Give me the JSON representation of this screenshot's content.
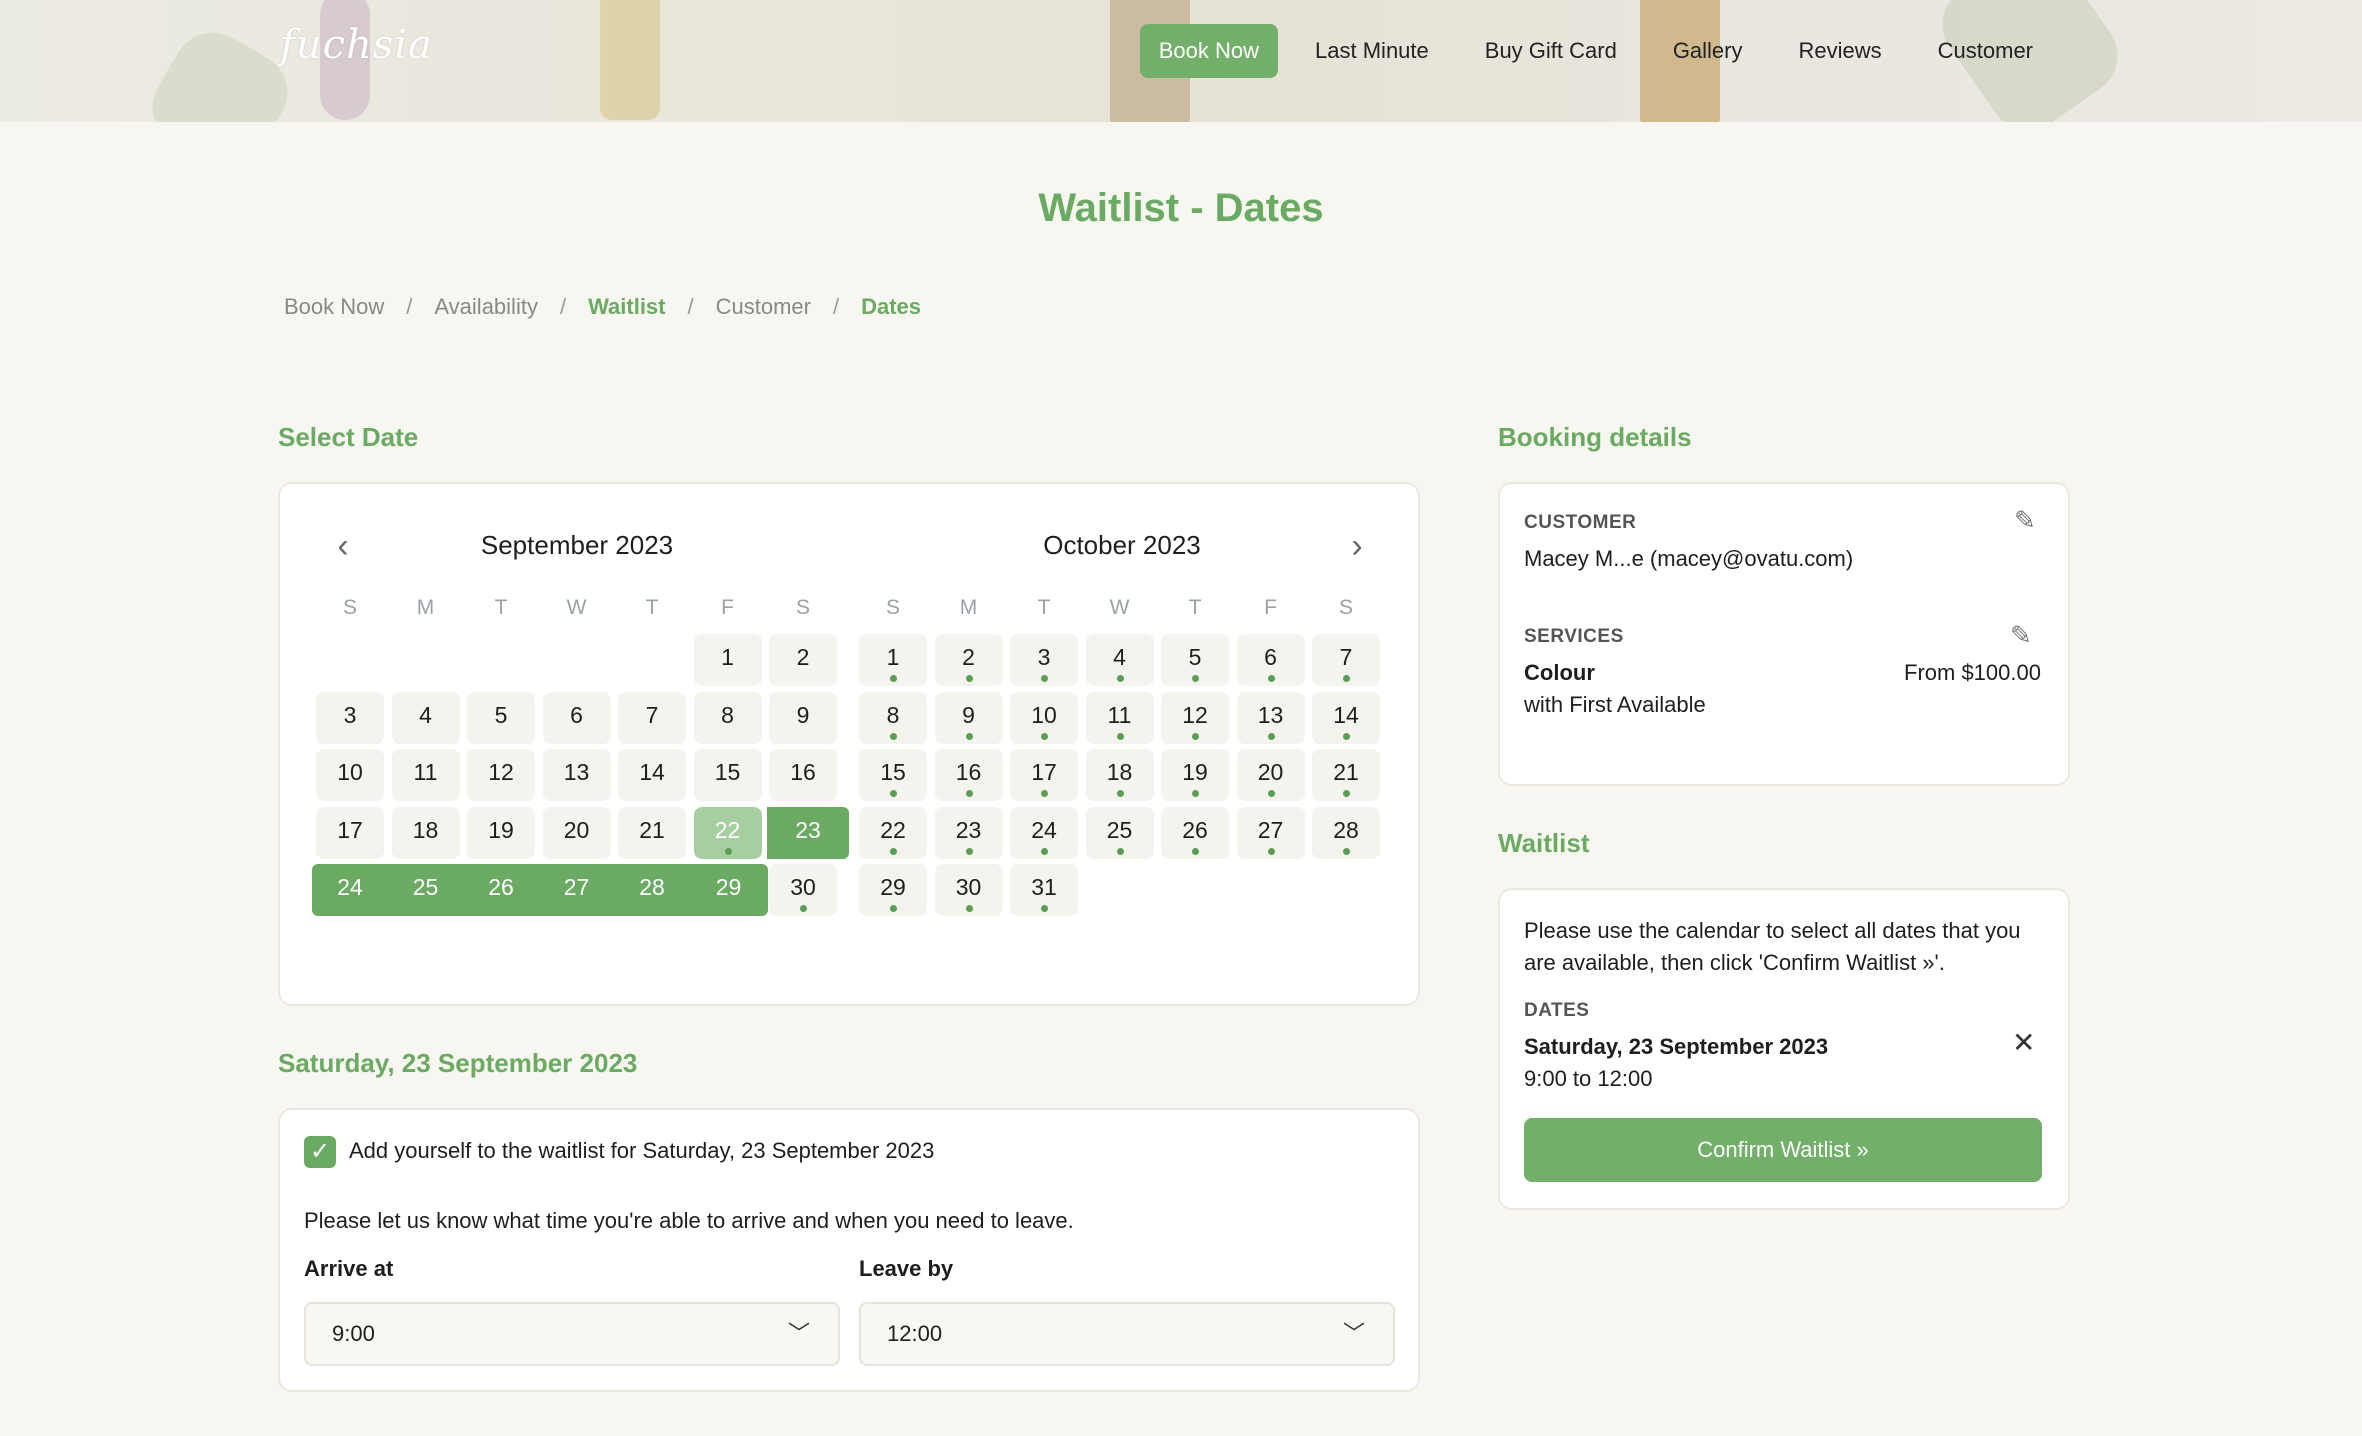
{
  "header": {
    "logo": "fuchsia",
    "nav": [
      "Book Now",
      "Last Minute",
      "Buy Gift Card",
      "Gallery",
      "Reviews",
      "Customer"
    ]
  },
  "page_title": "Waitlist - Dates",
  "breadcrumbs": [
    "Book Now",
    "Availability",
    "Waitlist",
    "Customer",
    "Dates"
  ],
  "breadcrumb_sep": "/",
  "select_date": {
    "title": "Select Date",
    "prev_icon": "chevron-left-icon",
    "next_icon": "chevron-right-icon",
    "weekdays": [
      "S",
      "M",
      "T",
      "W",
      "T",
      "F",
      "S"
    ],
    "months": [
      {
        "label": "September 2023",
        "first_weekday": 5,
        "days": 30,
        "dots": false
      },
      {
        "label": "October 2023",
        "first_weekday": 0,
        "days": 31,
        "dots": true
      }
    ],
    "selected_dates": [
      23,
      24,
      25,
      26,
      27,
      28,
      29
    ],
    "highlight_date": 22
  },
  "selected_day": {
    "title": "Saturday, 23 September 2023",
    "checkbox_label": "Add yourself to the waitlist for Saturday, 23 September 2023",
    "instructions": "Please let us know what time you're able to arrive and when you need to leave.",
    "arrive_label": "Arrive at",
    "arrive_value": "9:00",
    "leave_label": "Leave by",
    "leave_value": "12:00"
  },
  "booking_details": {
    "title": "Booking details",
    "customer_label": "CUSTOMER",
    "customer_value": "Macey M...e (macey@ovatu.com)",
    "services_label": "SERVICES",
    "service_name": "Colour",
    "service_staff": "with First Available",
    "service_price": "From $100.00"
  },
  "waitlist": {
    "title": "Waitlist",
    "instructions_1": "Please use the calendar to select all dates that you",
    "instructions_2": "are available, then click 'Confirm Waitlist »'.",
    "dates_label": "DATES",
    "date_value": "Saturday, 23 September 2023",
    "time_value": "9:00 to 12:00",
    "confirm_label": "Confirm Waitlist »"
  },
  "colors": {
    "accent": "#6aaa62",
    "dot": "#5a9e54"
  }
}
